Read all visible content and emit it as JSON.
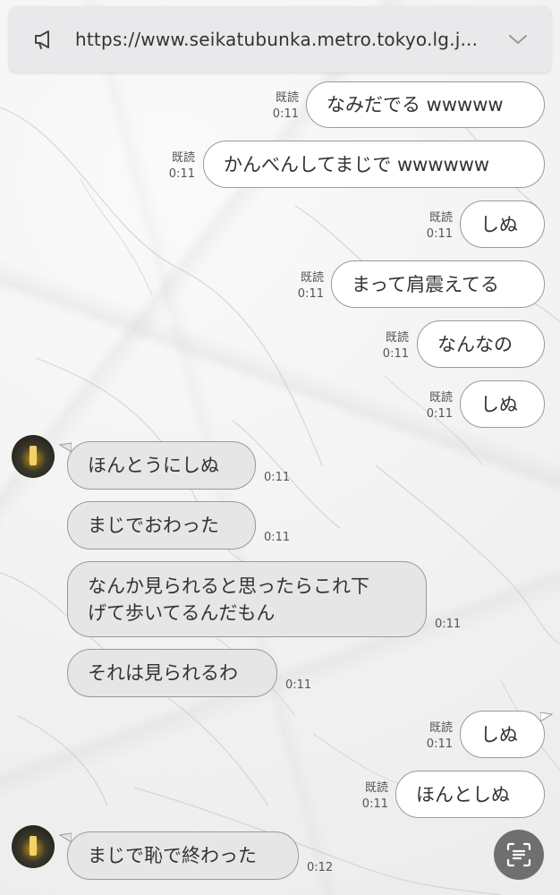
{
  "banner": {
    "url": "https://www.seikatubunka.metro.tokyo.lg.j...",
    "icon": "megaphone-icon",
    "expand_icon": "chevron-down-icon"
  },
  "messages": [
    {
      "dir": "out",
      "text": "なみだでる wwwww",
      "read": "既読",
      "time": "0:11"
    },
    {
      "dir": "out",
      "text": "かんべんしてまじで wwwwww",
      "read": "既読",
      "time": "0:11"
    },
    {
      "dir": "out",
      "text": "しぬ",
      "read": "既読",
      "time": "0:11"
    },
    {
      "dir": "out",
      "text": "まって肩震えてる",
      "read": "既読",
      "time": "0:11"
    },
    {
      "dir": "out",
      "text": "なんなの",
      "read": "既読",
      "time": "0:11"
    },
    {
      "dir": "out",
      "text": "しぬ",
      "read": "既読",
      "time": "0:11"
    },
    {
      "dir": "in",
      "text": "ほんとうにしぬ",
      "time": "0:11"
    },
    {
      "dir": "in",
      "text": "まじでおわった",
      "time": "0:11"
    },
    {
      "dir": "in",
      "text": "なんか見られると思ったらこれ下げて歩いてるんだもん",
      "line1": "なんか見られると思ったらこれ下",
      "line2": "げて歩いてるんだもん",
      "time": "0:11"
    },
    {
      "dir": "in",
      "text": "それは見られるわ",
      "time": "0:11"
    },
    {
      "dir": "out",
      "text": "しぬ",
      "read": "既読",
      "time": "0:11"
    },
    {
      "dir": "out",
      "text": "ほんとしぬ",
      "read": "既読",
      "time": "0:11"
    },
    {
      "dir": "in",
      "text": "まじで恥で終わった",
      "time": "0:12"
    }
  ],
  "scan_button": {
    "icon": "text-scan-icon"
  },
  "colors": {
    "outgoing_bubble": "#ffffff",
    "incoming_bubble": "#e6e6e6",
    "banner": "#e9e9eb",
    "scan_button": "#6f6f6f"
  }
}
